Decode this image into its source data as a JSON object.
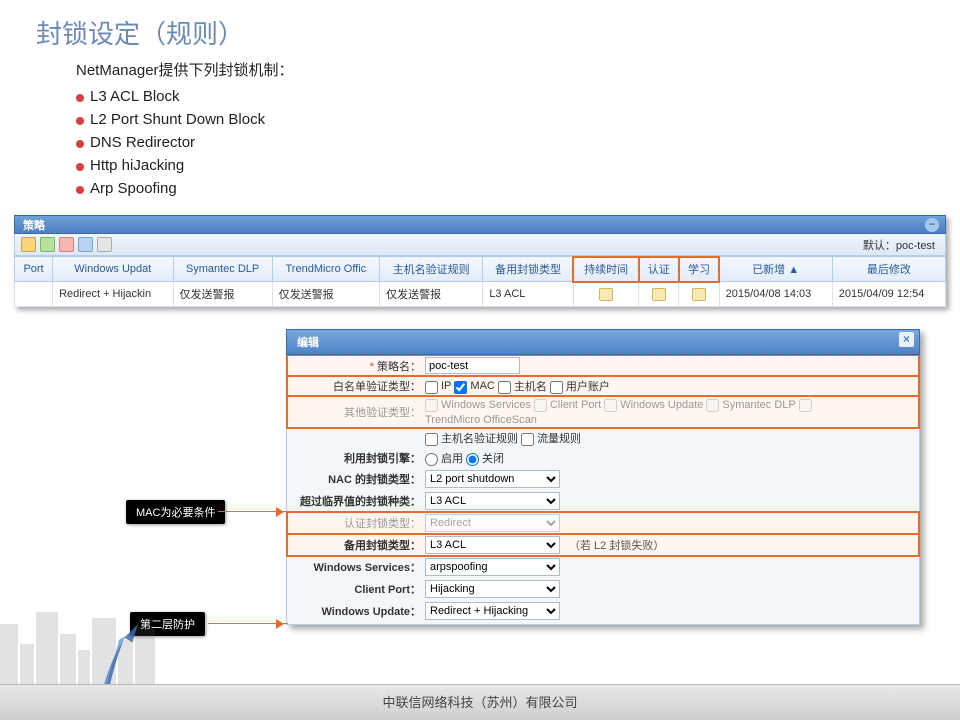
{
  "slide": {
    "title": "封锁设定（规则）",
    "intro": "NetManager提供下列封锁机制：",
    "bullets": [
      "L3 ACL Block",
      "L2 Port Shunt Down Block",
      "DNS Redirector",
      "Http hiJacking",
      "Arp Spoofing"
    ]
  },
  "panel1": {
    "title": "策略",
    "default_label": "默认：poc-test",
    "headers": [
      "Port",
      "Windows Updat",
      "Symantec DLP",
      "TrendMicro Offic",
      "主机名验证规则",
      "备用封锁类型",
      "持续时间",
      "认证",
      "学习",
      "已新增 ▲",
      "最后修改"
    ],
    "row": [
      "",
      "Redirect + Hijackin",
      "仅发送警报",
      "仅发送警报",
      "仅发送警报",
      "L3 ACL",
      "icon",
      "icon",
      "icon",
      "2015/04/08 14:03",
      "2015/04/09 12:54"
    ]
  },
  "panel2": {
    "title": "编辑",
    "labels": {
      "name": "策略名：",
      "wl": "白名单验证类型：",
      "other": "其他验证类型：",
      "sub": "",
      "engine": "利用封锁引擎：",
      "nac": "NAC 的封锁类型：",
      "over": "超过临界值的封锁种类：",
      "auth": "认证封锁类型：",
      "backup": "备用封锁类型：",
      "ws": "Windows Services：",
      "cp": "Client Port：",
      "wu": "Windows Update："
    },
    "values": {
      "name": "poc-test",
      "wl_opts": [
        "IP",
        "MAC",
        "主机名",
        "用户账户"
      ],
      "other_opts": [
        "Windows Services",
        "Client Port",
        "Windows Update",
        "Symantec DLP",
        "TrendMicro OfficeScan"
      ],
      "sub_opts": [
        "主机名验证规则",
        "流量规则"
      ],
      "engine_on": "启用",
      "engine_off": "关闭",
      "nac": "L2 port shutdown",
      "over": "L3 ACL",
      "auth": "Redirect",
      "backup": "L3 ACL",
      "backup_note": "（若 L2 封锁失败）",
      "ws": "arpspoofing",
      "cp": "Hijacking",
      "wu": "Redirect + Hijacking"
    }
  },
  "callouts": {
    "mac": "MAC为必要条件",
    "layer2": "第二层防护"
  },
  "footer": "中联信网络科技（苏州）有限公司"
}
